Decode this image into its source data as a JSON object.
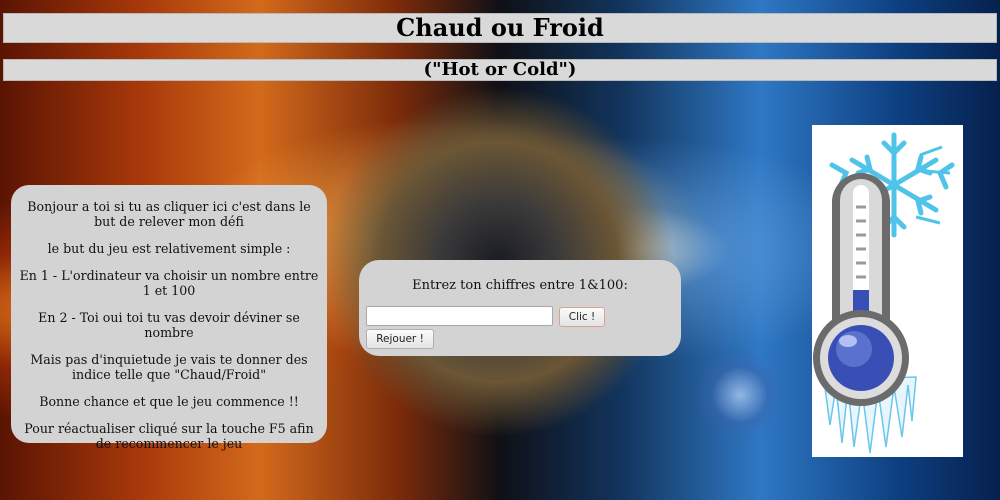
{
  "header": {
    "title": "Chaud ou Froid",
    "subtitle": "(\"Hot or Cold\")"
  },
  "intro": {
    "paragraphs": [
      "Bonjour a toi si tu as cliquer ici c'est dans le but de relever mon défi",
      "le but du jeu est relativement simple :",
      "En 1 - L'ordinateur va choisir un nombre entre 1 et 100",
      "En 2 - Toi oui toi tu vas devoir déviner se nombre",
      "Mais pas d'inquietude je vais te donner des indice telle que \"Chaud/Froid\"",
      "Bonne chance et que le jeu commence !!",
      "Pour réactualiser cliqué sur la touche F5 afin de recommencer le jeu"
    ]
  },
  "game": {
    "prompt": "Entrez ton chiffres entre 1&100:",
    "input_value": "",
    "submit_label": "Clic !",
    "reset_label": "Rejouer !"
  },
  "image": {
    "icon": "thermometer-snowflake-icon",
    "colors": {
      "snow": "#4fc3e8",
      "bulb": "#3a4fb5",
      "frame": "#6b6b6b"
    }
  }
}
